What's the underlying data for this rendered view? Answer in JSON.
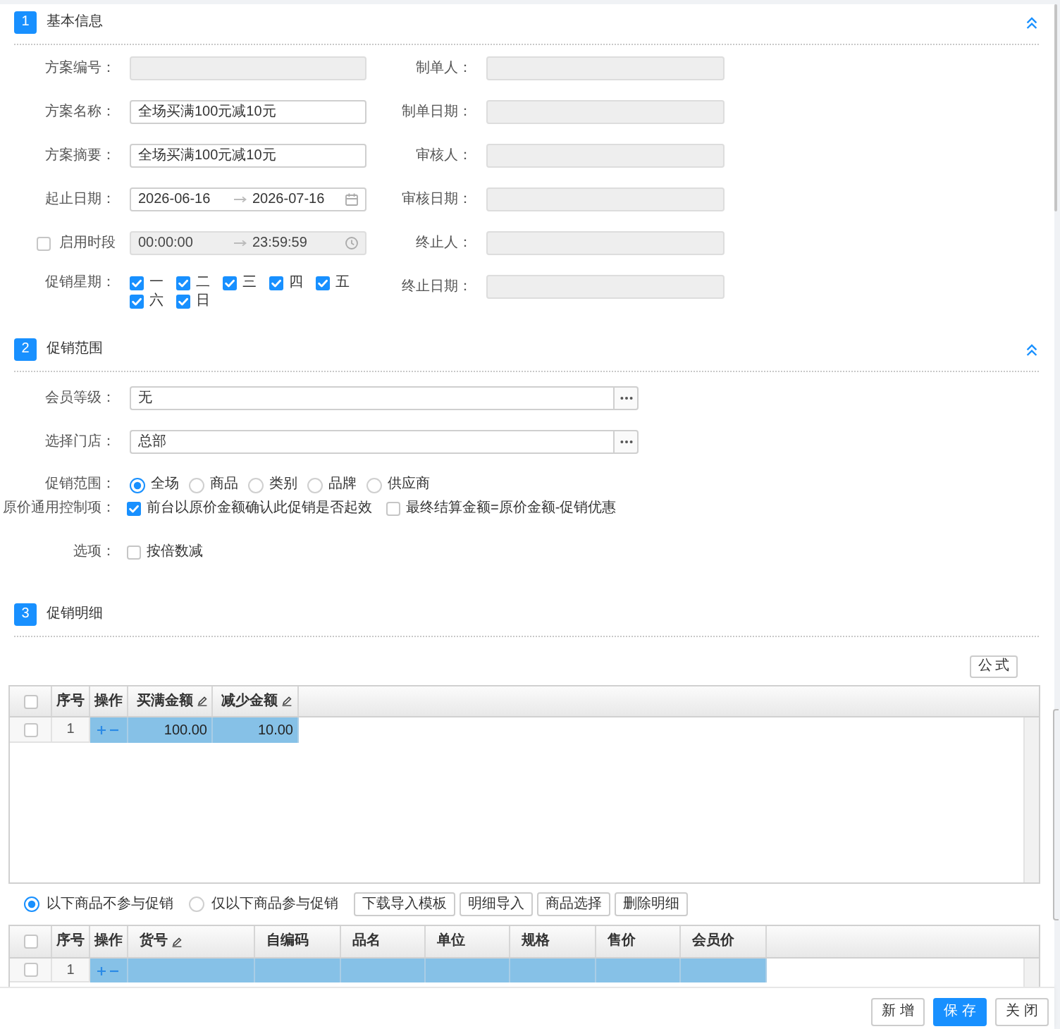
{
  "basic_info": {
    "number": "1",
    "title": "基本信息",
    "expanded": true,
    "left_fields": [
      {
        "kind": "text",
        "label": "方案编号：",
        "disabled": true
      },
      {
        "kind": "text",
        "label": "方案名称：",
        "value": "全场买满100元减10元",
        "disabled": false
      },
      {
        "kind": "text",
        "label": "方案摘要：",
        "value": "全场买满100元减10元",
        "disabled": false
      },
      {
        "kind": "date_range",
        "label": "起止日期：",
        "start": "2026-06-16",
        "end": "2026-07-16",
        "disabled": false
      },
      {
        "kind": "time_range",
        "label": "启用时段",
        "checked": false,
        "start": "00:00:00",
        "end": "23:59:59",
        "disabled": true
      },
      {
        "kind": "weekdays",
        "label": "促销星期：",
        "days": [
          {
            "label": "一",
            "checked": true
          },
          {
            "label": "二",
            "checked": true
          },
          {
            "label": "三",
            "checked": true
          },
          {
            "label": "四",
            "checked": true
          },
          {
            "label": "五",
            "checked": true
          },
          {
            "label": "六",
            "checked": true
          },
          {
            "label": "日",
            "checked": true
          }
        ]
      }
    ],
    "right_fields": [
      {
        "kind": "text",
        "label": "制单人：",
        "disabled": true
      },
      {
        "kind": "text",
        "label": "制单日期：",
        "disabled": true
      },
      {
        "kind": "text",
        "label": "审核人：",
        "disabled": true
      },
      {
        "kind": "text",
        "label": "审核日期：",
        "disabled": true
      },
      {
        "kind": "text",
        "label": "终止人：",
        "disabled": true
      },
      {
        "kind": "text",
        "label": "终止日期：",
        "disabled": true
      }
    ]
  },
  "scope": {
    "number": "2",
    "title": "促销范围",
    "expanded": true,
    "fields": [
      {
        "kind": "picker",
        "label": "会员等级：",
        "value": "无"
      },
      {
        "kind": "picker",
        "label": "选择门店：",
        "value": "总部"
      },
      {
        "kind": "radio",
        "label": "促销范围：",
        "options": [
          {
            "label": "全场",
            "selected": true
          },
          {
            "label": "商品",
            "selected": false
          },
          {
            "label": "类别",
            "selected": false
          },
          {
            "label": "品牌",
            "selected": false
          },
          {
            "label": "供应商",
            "selected": false
          }
        ]
      },
      {
        "kind": "checkboxes",
        "label": "原价通用控制项：",
        "options": [
          {
            "label": "前台以原价金额确认此促销是否起效",
            "checked": true
          },
          {
            "label": "最终结算金额=原价金额-促销优惠",
            "checked": false
          }
        ]
      },
      {
        "kind": "checkboxes",
        "label": "选项：",
        "options": [
          {
            "label": "按倍数减",
            "checked": false
          }
        ]
      }
    ]
  },
  "details": {
    "number": "3",
    "title": "促销明细",
    "formula_button": "公式",
    "rule_table": {
      "columns": [
        {
          "kind": "select",
          "checked": false
        },
        {
          "kind": "index",
          "label": "序号"
        },
        {
          "kind": "action",
          "label": "操作"
        },
        {
          "kind": "data",
          "label": "买满金额",
          "editable": true
        },
        {
          "kind": "data",
          "label": "减少金额",
          "editable": true
        }
      ],
      "rows": [
        {
          "checked": false,
          "number": "1",
          "selected": true,
          "values": [
            "100.00",
            "10.00"
          ]
        }
      ]
    },
    "product_scope": {
      "options": [
        {
          "label": "以下商品不参与促销",
          "selected": true
        },
        {
          "label": "仅以下商品参与促销",
          "selected": false
        }
      ],
      "buttons": [
        "下载导入模板",
        "明细导入",
        "商品选择",
        "删除明细"
      ]
    },
    "product_table": {
      "columns": [
        {
          "kind": "select",
          "checked": false
        },
        {
          "kind": "index",
          "label": "序号"
        },
        {
          "kind": "action",
          "label": "操作"
        },
        {
          "kind": "data",
          "label": "货号",
          "editable": true
        },
        {
          "kind": "data",
          "label": "自编码",
          "editable": false
        },
        {
          "kind": "data",
          "label": "品名",
          "editable": false
        },
        {
          "kind": "data",
          "label": "单位",
          "editable": false
        },
        {
          "kind": "data",
          "label": "规格",
          "editable": false
        },
        {
          "kind": "data",
          "label": "售价",
          "editable": false
        },
        {
          "kind": "data",
          "label": "会员价",
          "editable": false
        }
      ],
      "rows": [
        {
          "checked": false,
          "number": "1",
          "selected": true
        }
      ]
    }
  },
  "footer": {
    "buttons": [
      {
        "label": "新增",
        "kind": "default"
      },
      {
        "label": "保存",
        "kind": "primary"
      },
      {
        "label": "关闭",
        "kind": "default"
      }
    ]
  }
}
